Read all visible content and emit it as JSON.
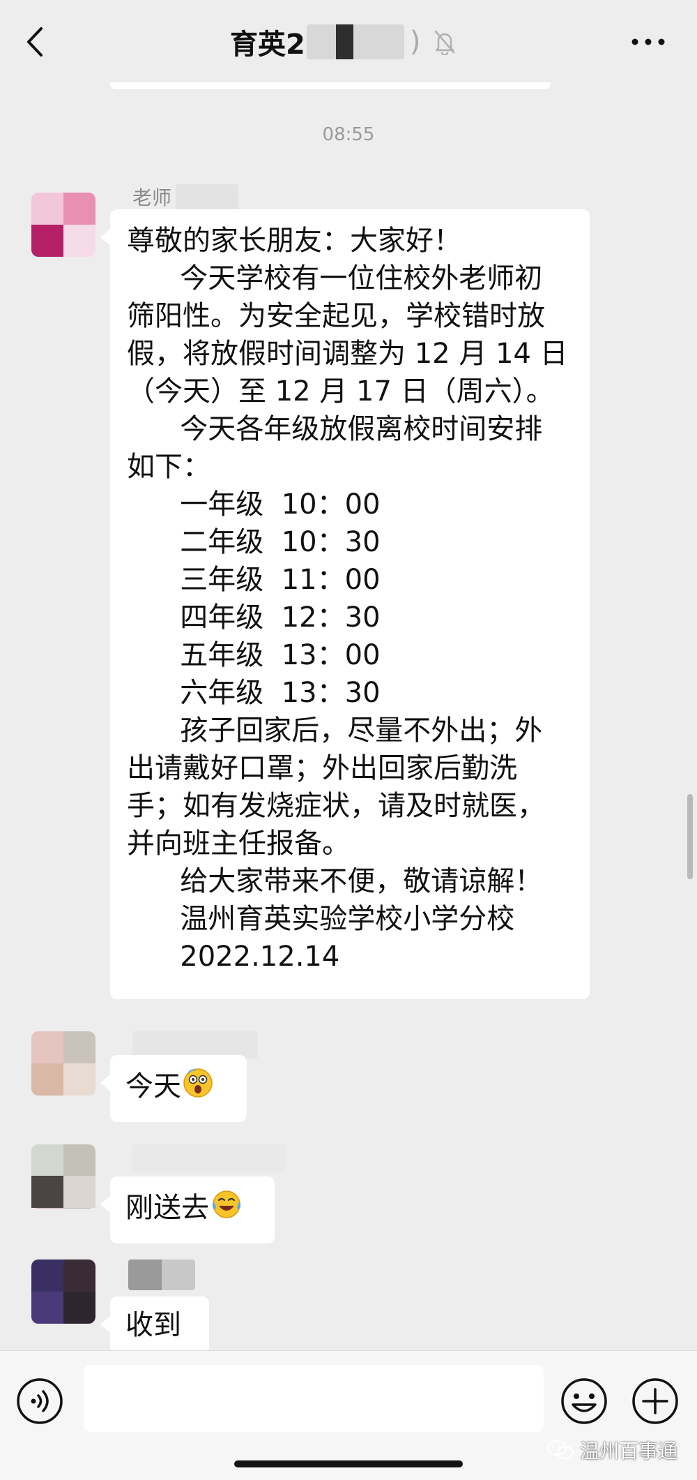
{
  "header": {
    "title": "育英2",
    "paren": ")"
  },
  "timestamp": "08:55",
  "messages": [
    {
      "sender": "老师",
      "lines": [
        "尊敬的家长朋友：大家好！",
        "      今天学校有一位住校外老师初",
        "筛阳性。为安全起见，学校错时放",
        "假，将放假时间调整为 12 月 14 日",
        "（今天）至 12 月 17 日（周六）。",
        "      今天各年级放假离校时间安排",
        "如下：",
        "      一年级  10：00",
        "      二年级  10：30",
        "      三年级  11：00",
        "      四年级  12：30",
        "      五年级  13：00",
        "      六年级  13：30",
        "      孩子回家后，尽量不外出；外",
        "出请戴好口罩；外出回家后勤洗",
        "手；如有发烧症状，请及时就医，",
        "并向班主任报备。",
        "      给大家带来不便，敬请谅解！",
        "      温州育英实验学校小学分校",
        "      2022.12.14"
      ]
    },
    {
      "text": "今天",
      "emoji": "shocked-emoji"
    },
    {
      "text": "刚送去",
      "emoji": "crying-laughing-emoji"
    },
    {
      "text": "收到"
    }
  ],
  "input": {
    "placeholder": ""
  },
  "watermark": "温州百事通",
  "colors": {
    "background": "#ededed",
    "bubble": "#ffffff",
    "timestamp": "#9a9a9a"
  }
}
